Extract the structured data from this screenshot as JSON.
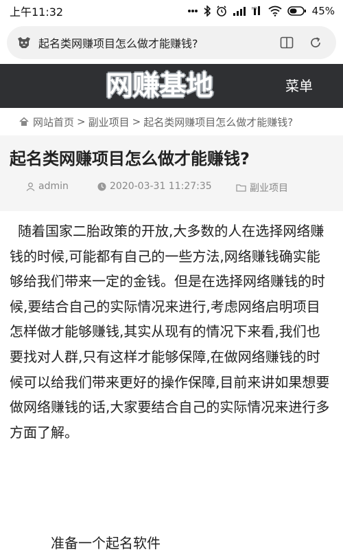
{
  "status_bar": {
    "time": "上午11:32",
    "network": "4G",
    "battery": "45%"
  },
  "browser": {
    "url_text": "起名类网赚项目怎么做才能赚钱?",
    "icons": [
      "site-favicon-icon",
      "reader-mode-icon",
      "refresh-icon"
    ]
  },
  "site": {
    "logo_text": "网赚基地",
    "menu_label": "菜单"
  },
  "breadcrumb": {
    "home": "网站首页",
    "separator": ">",
    "category": "副业项目",
    "current": "起名类网赚项目怎么做才能赚钱?"
  },
  "article": {
    "title": "起名类网赚项目怎么做才能赚钱?",
    "author": "admin",
    "datetime": "2020-03-31 11:27:35",
    "category": "副业项目",
    "paragraph": "随着国家二胎政策的开放,大多数的人在选择网络赚钱的时候,可能都有自己的一些方法,网络赚钱确实能够给我们带来一定的金钱。但是在选择网络赚钱的时候,要结合自己的实际情况来进行,考虑网络启明项目怎样做才能够赚钱,其实从现有的情况下来看,我们也要找对人群,只有这样才能够保障,在做网络赚钱的时候可以给我们带来更好的操作保障,目前来讲如果想要做网络赚钱的话,大家要结合自己的实际情况来进行多方面了解。",
    "subheading": "准备一个起名软件"
  }
}
